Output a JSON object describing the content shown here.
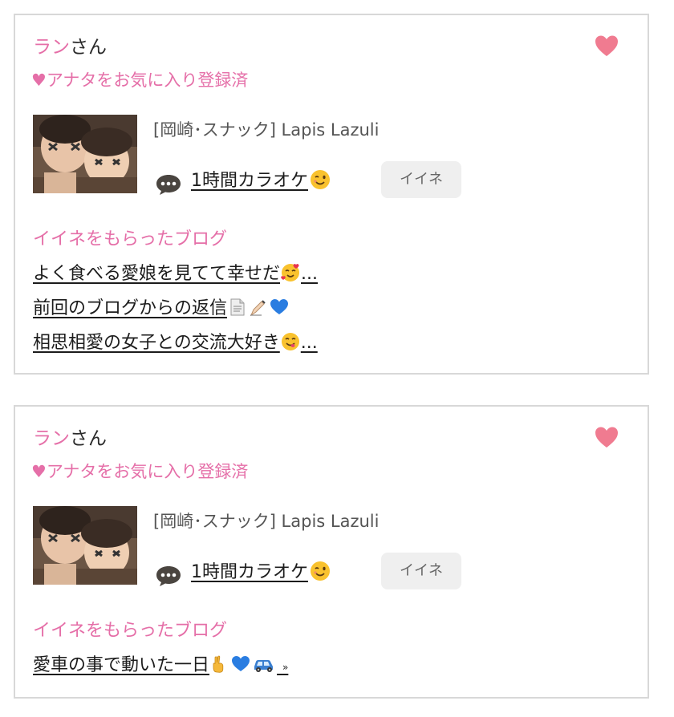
{
  "cards": [
    {
      "name_pink": "ラン",
      "name_suffix": "さん",
      "favorite_text": "♥アナタをお気に入り登録済",
      "shop": "[岡崎･スナック]  Lapis Lazuli",
      "post_title": "1時間カラオケ",
      "iine_label": "イイネ",
      "blog_heading": "イイネをもらったブログ",
      "blogs": [
        {
          "text": "よく食べる愛娘を見てて幸せだ",
          "suffix": "..."
        },
        {
          "text": "前回のブログからの返信",
          "suffix": ""
        },
        {
          "text": "相思相愛の女子との交流大好き",
          "suffix": "..."
        }
      ]
    },
    {
      "name_pink": "ラン",
      "name_suffix": "さん",
      "favorite_text": "♥アナタをお気に入り登録済",
      "shop": "[岡崎･スナック]  Lapis Lazuli",
      "post_title": "1時間カラオケ",
      "iine_label": "イイネ",
      "blog_heading": "イイネをもらったブログ",
      "blogs": [
        {
          "text": "愛車の事で動いた一日",
          "suffix": "»"
        }
      ]
    }
  ],
  "icons": {
    "heart": "heart-icon",
    "bubble": "speech-bubble-icon",
    "wink": "winking-face-emoji",
    "smiling_hearts": "smiling-face-with-hearts-emoji",
    "page": "page-icon",
    "writing_hand": "writing-hand-icon",
    "blue_heart": "blue-heart-emoji",
    "tongue_face": "face-savoring-food-emoji",
    "crossed_fingers": "crossed-fingers-emoji",
    "car": "car-emoji"
  },
  "colors": {
    "accent_pink": "#e56fa8",
    "heart_pink": "#f07b90",
    "button_bg": "#efefef"
  }
}
